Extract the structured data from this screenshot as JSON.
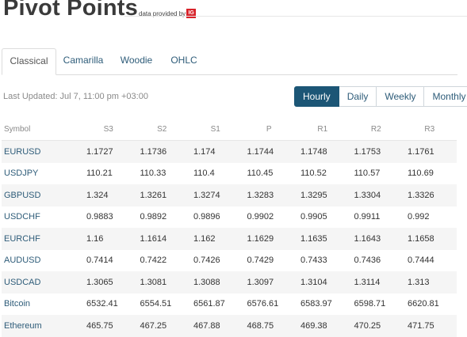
{
  "page": {
    "title": "Pivot Points",
    "provider_text": "data provided by",
    "provider_logo": "IG"
  },
  "tabs": [
    {
      "label": "Classical",
      "active": true
    },
    {
      "label": "Camarilla",
      "active": false
    },
    {
      "label": "Woodie",
      "active": false
    },
    {
      "label": "OHLC",
      "active": false
    }
  ],
  "last_updated": "Last Updated: Jul 7, 11:00 pm +03:00",
  "timeframes": [
    {
      "label": "Hourly",
      "active": true
    },
    {
      "label": "Daily",
      "active": false
    },
    {
      "label": "Weekly",
      "active": false
    },
    {
      "label": "Monthly",
      "active": false
    }
  ],
  "table": {
    "columns": [
      "Symbol",
      "S3",
      "S2",
      "S1",
      "P",
      "R1",
      "R2",
      "R3"
    ],
    "rows": [
      [
        "EURUSD",
        "1.1727",
        "1.1736",
        "1.174",
        "1.1744",
        "1.1748",
        "1.1753",
        "1.1761"
      ],
      [
        "USDJPY",
        "110.21",
        "110.33",
        "110.4",
        "110.45",
        "110.52",
        "110.57",
        "110.69"
      ],
      [
        "GBPUSD",
        "1.324",
        "1.3261",
        "1.3274",
        "1.3283",
        "1.3295",
        "1.3304",
        "1.3326"
      ],
      [
        "USDCHF",
        "0.9883",
        "0.9892",
        "0.9896",
        "0.9902",
        "0.9905",
        "0.9911",
        "0.992"
      ],
      [
        "EURCHF",
        "1.16",
        "1.1614",
        "1.162",
        "1.1629",
        "1.1635",
        "1.1643",
        "1.1658"
      ],
      [
        "AUDUSD",
        "0.7414",
        "0.7422",
        "0.7426",
        "0.7429",
        "0.7433",
        "0.7436",
        "0.7444"
      ],
      [
        "USDCAD",
        "1.3065",
        "1.3081",
        "1.3088",
        "1.3097",
        "1.3104",
        "1.3114",
        "1.313"
      ],
      [
        "Bitcoin",
        "6532.41",
        "6554.51",
        "6561.87",
        "6576.61",
        "6583.97",
        "6598.71",
        "6620.81"
      ],
      [
        "Ethereum",
        "465.75",
        "467.25",
        "467.88",
        "468.75",
        "469.38",
        "470.25",
        "471.75"
      ]
    ]
  },
  "colors": {
    "accent": "#1c5676",
    "link": "#2e5c79",
    "stripe": "#f5f5f5",
    "logo": "#d8232a"
  }
}
